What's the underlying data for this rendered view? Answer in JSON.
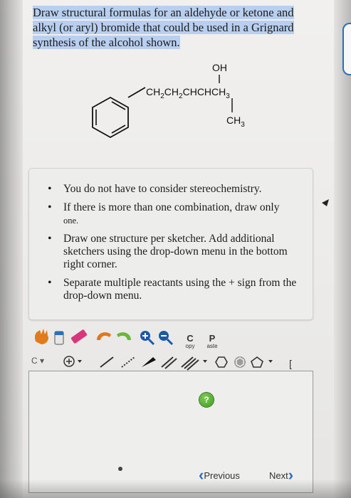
{
  "question": {
    "text": "Draw structural formulas for an aldehyde or ketone and alkyl (or aryl) bromide that could be used in a Grignard synthesis of the alcohol shown."
  },
  "molecule": {
    "oh_label": "OH",
    "chain_label": "CH2CH2CHCHCH3",
    "methyl_label": "CH3"
  },
  "instructions": [
    {
      "main": "You do not have to consider stereochemistry."
    },
    {
      "main": "If there is more than one combination, draw only",
      "tail": "one."
    },
    {
      "main": "Draw one structure per sketcher. Add additional sketchers using the drop-down menu in the",
      "tail": "bottom right corner."
    },
    {
      "main": "Separate multiple reactants using the + sign from the drop-down menu."
    }
  ],
  "toolbar": {
    "copy_big": "C",
    "copy_small": "opy",
    "paste_big": "P",
    "paste_small": "aste",
    "element_select": "C",
    "bracket": "["
  },
  "sketcher": {
    "help_label": "?"
  },
  "nav": {
    "previous": "Previous",
    "next": "Next"
  }
}
